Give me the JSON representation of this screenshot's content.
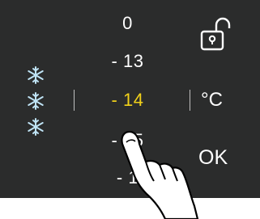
{
  "freezer_menu": {
    "values": [
      "0",
      "- 13",
      "- 14",
      "- 15",
      "- 1"
    ],
    "selected_value": "- 14",
    "unit_label": "°C",
    "ok_label": "OK"
  },
  "icons": {
    "snowflake": "snowflake-icon",
    "lock": "unlocked-padlock-icon",
    "hand": "pointing-hand-icon"
  },
  "colors": {
    "panel_background": "#2b2c2c",
    "text": "#ffffff",
    "selected_value": "#f2d21a"
  }
}
